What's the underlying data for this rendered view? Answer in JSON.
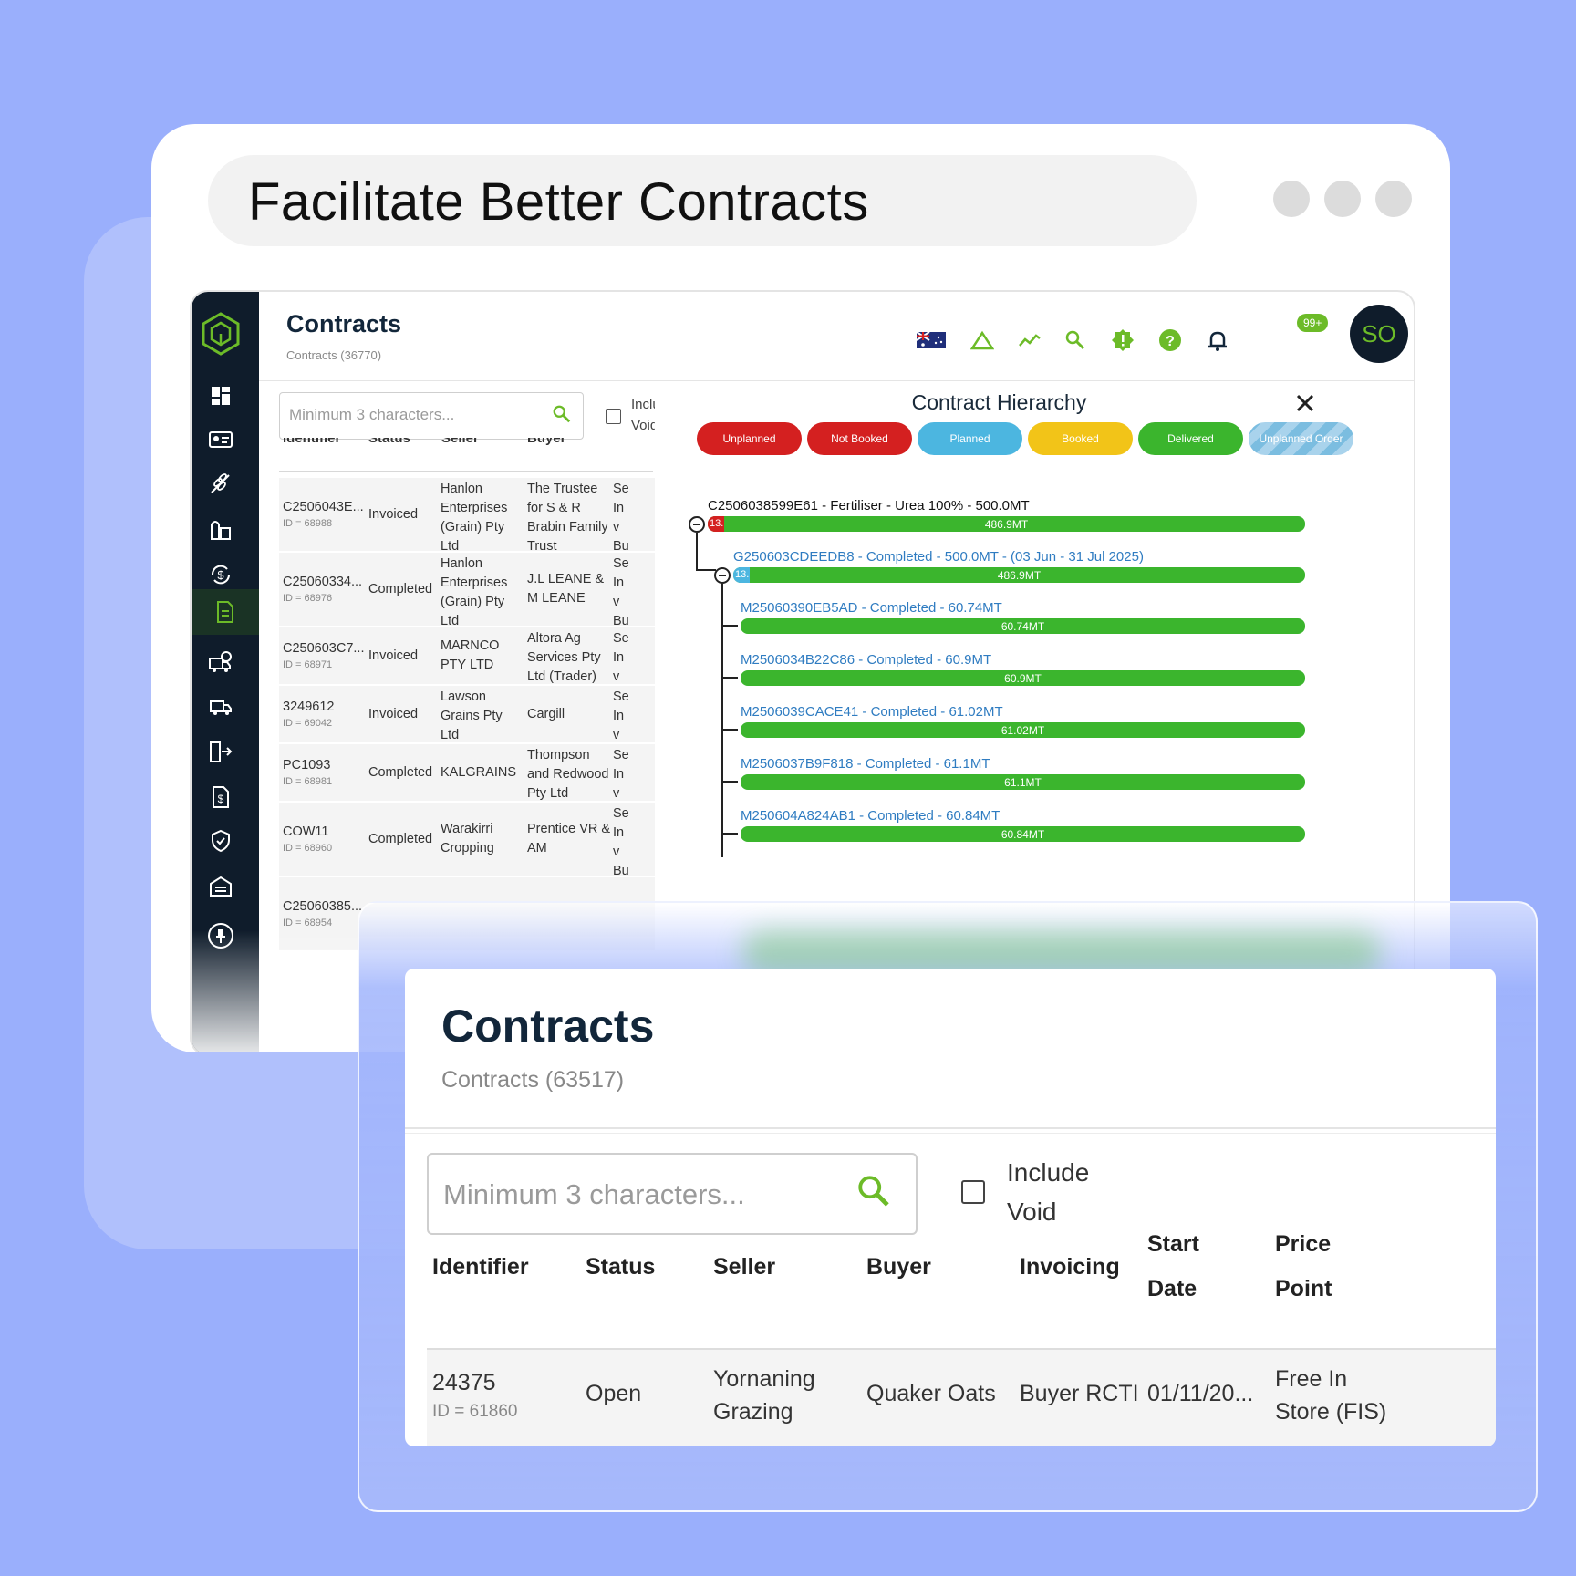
{
  "headline": "Facilitate Better Contracts",
  "app": {
    "title": "Contracts",
    "subtitle": "Contracts (36770)",
    "notification_badge": "99+",
    "avatar_initials": "SO",
    "accent": "#6cbb28",
    "sidebar_dark": "#0f1c2b",
    "search_placeholder": "Minimum 3 characters...",
    "include_void_label": "Inclu Void",
    "nav_icons": [
      "dashboard-icon",
      "contact-card-icon",
      "wheat-icon",
      "silo-icon",
      "currency-exchange-icon",
      "contracts-icon",
      "truck-time-icon",
      "delivery-truck-icon",
      "storage-exit-icon",
      "invoice-icon",
      "shield-check-icon",
      "warehouse-icon",
      "pin-icon"
    ],
    "top_icons": [
      "australia-flag-icon",
      "warning-triangle-icon",
      "trend-icon",
      "search-icon",
      "alert-badge-icon",
      "help-icon",
      "bell-icon"
    ],
    "rows": [
      {
        "identifier": "C2506043E...",
        "id": "ID = 68988",
        "status": "Invoiced",
        "seller": "Hanlon Enterprises (Grain) Pty Ltd",
        "buyer": "The Trustee for S & R Brabin Family Trust",
        "inv": "Se Inv Bu"
      },
      {
        "identifier": "C25060334...",
        "id": "ID = 68976",
        "status": "Completed",
        "seller": "Hanlon Enterprises (Grain) Pty Ltd",
        "buyer": "J.L LEANE & M LEANE",
        "inv": "Se Inv Bu"
      },
      {
        "identifier": "C250603C7...",
        "id": "ID = 68971",
        "status": "Invoiced",
        "seller": "MARNCO PTY LTD",
        "buyer": "Altora Ag Services Pty Ltd (Trader)",
        "inv": "Se Inv Bu"
      },
      {
        "identifier": "3249612",
        "id": "ID = 69042",
        "status": "Invoiced",
        "seller": "Lawson Grains Pty Ltd",
        "buyer": "Cargill",
        "inv": "Se Inv Bu"
      },
      {
        "identifier": "PC1093",
        "id": "ID = 68981",
        "status": "Completed",
        "seller": "KALGRAINS",
        "buyer": "Thompson and Redwood Pty Ltd",
        "inv": "Se Inv Bu"
      },
      {
        "identifier": "COW11",
        "id": "ID = 68960",
        "status": "Completed",
        "seller": "Warakirri Cropping",
        "buyer": "Prentice VR & AM",
        "inv": "Se Inv Bu"
      },
      {
        "identifier": "C25060385...",
        "id": "ID = 68954",
        "status": "",
        "seller": "",
        "buyer": "",
        "inv": ""
      }
    ]
  },
  "hierarchy": {
    "title": "Contract Hierarchy",
    "legend": [
      {
        "label": "Unplanned",
        "color": "#d42020"
      },
      {
        "label": "Not Booked",
        "color": "#d42020"
      },
      {
        "label": "Planned",
        "color": "#4cb6e0"
      },
      {
        "label": "Booked",
        "color": "#f2c418"
      },
      {
        "label": "Delivered",
        "color": "#3bb52d"
      },
      {
        "label": "Unplanned Order",
        "color": "#6fb4dc"
      }
    ],
    "root": {
      "label": "C2506038599E61 - Fertiliser - Urea 100% - 500.0MT",
      "bar": "486.9MT",
      "chip": "13."
    },
    "order": {
      "label": "G250603CDEEDB8 - Completed - 500.0MT - (03 Jun - 31 Jul 2025)",
      "bar": "486.9MT",
      "chip": "13."
    },
    "movements": [
      {
        "label": "M25060390EB5AD - Completed - 60.74MT",
        "bar": "60.74MT"
      },
      {
        "label": "M2506034B22C86 - Completed - 60.9MT",
        "bar": "60.9MT"
      },
      {
        "label": "M2506039CACE41 - Completed - 61.02MT",
        "bar": "61.02MT"
      },
      {
        "label": "M2506037B9F818 - Completed - 61.1MT",
        "bar": "61.1MT"
      },
      {
        "label": "M250604A824AB1 - Completed - 60.84MT",
        "bar": "60.84MT"
      }
    ]
  },
  "front": {
    "title": "Contracts",
    "subtitle": "Contracts (63517)",
    "search_placeholder": "Minimum 3 characters...",
    "include_void": [
      "Include",
      "Void"
    ],
    "columns": [
      "Identifier",
      "Status",
      "Seller",
      "Buyer",
      "Invoicing",
      "Start Date",
      "Price Point"
    ],
    "row": {
      "identifier": "24375",
      "id": "ID = 61860",
      "status": "Open",
      "seller": "Yornaning Grazing",
      "buyer": "Quaker Oats",
      "invoicing": "Buyer RCTI",
      "start_date": "01/11/20...",
      "price_point": "Free In Store (FIS)"
    }
  }
}
